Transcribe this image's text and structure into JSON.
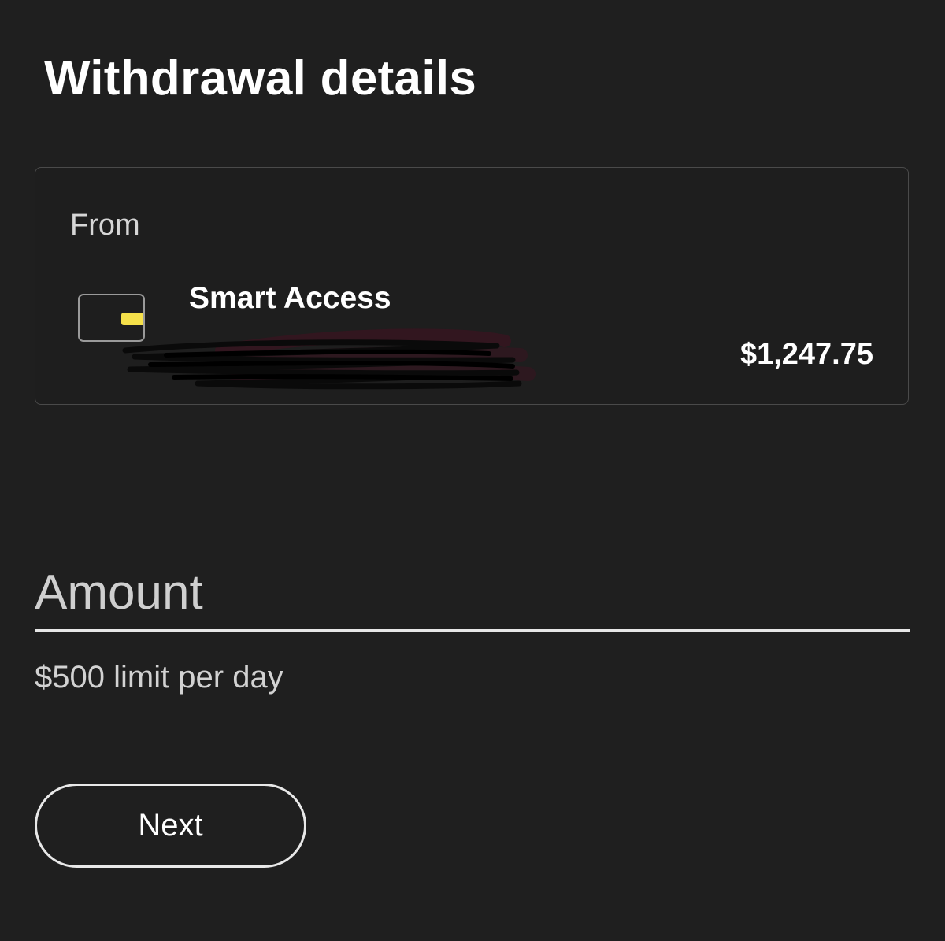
{
  "page": {
    "title": "Withdrawal details",
    "background_color": "#1f1f1f"
  },
  "from_account": {
    "label": "From",
    "icon": "card-icon",
    "chip_color": "#f5e04a",
    "name": "Smart Access",
    "balance": "$1,247.75"
  },
  "amount": {
    "placeholder": "Amount",
    "value": ""
  },
  "limit_text": "$500 limit per day",
  "actions": {
    "next_label": "Next"
  }
}
